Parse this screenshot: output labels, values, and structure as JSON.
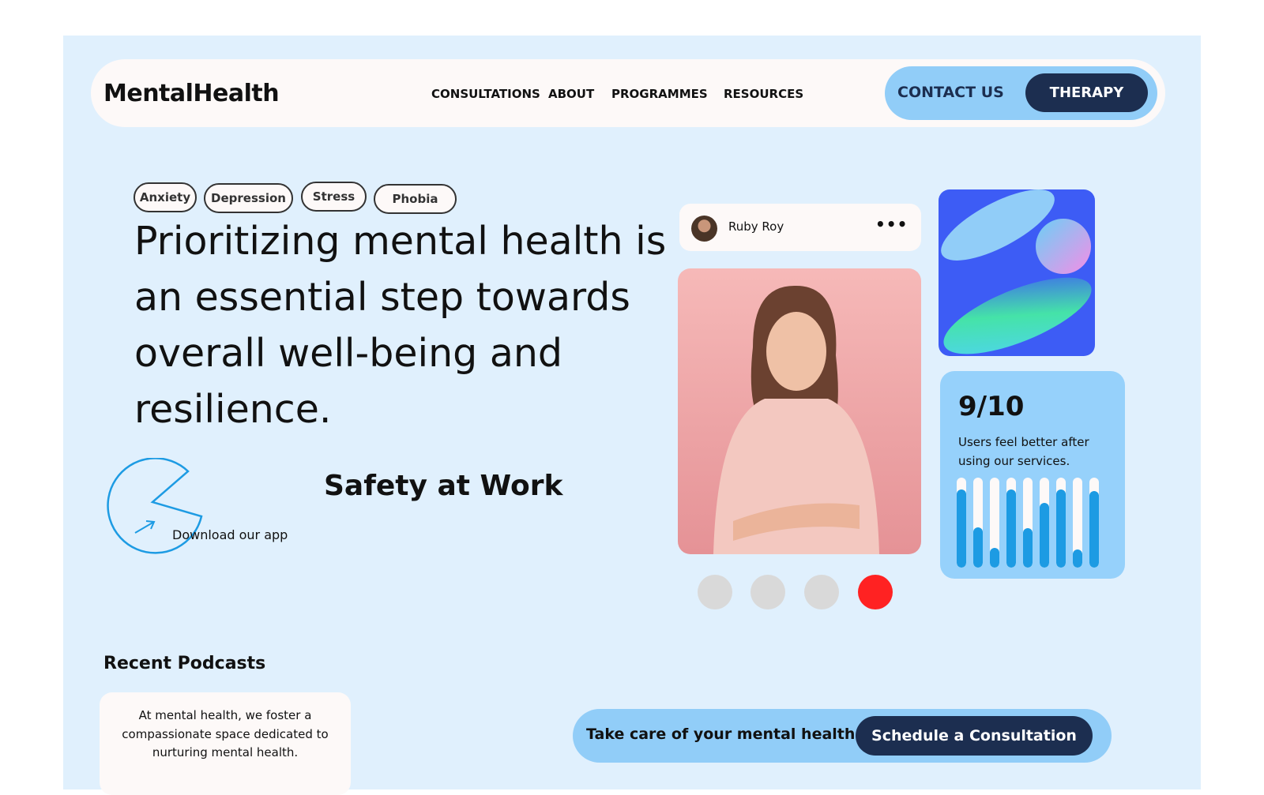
{
  "nav": {
    "logo": "MentalHealth",
    "links": [
      "CONSULTATIONS",
      "ABOUT",
      "PROGRAMMES",
      "RESOURCES"
    ],
    "contact": "CONTACT US",
    "therapy": "THERAPY"
  },
  "hero": {
    "tags": [
      "Anxiety",
      "Depression",
      "Stress",
      "Phobia"
    ],
    "headline": "Prioritizing mental health is an essential step towards overall well-being and resilience.",
    "download": "Download our app",
    "safety": "Safety at Work"
  },
  "profile": {
    "name": "Ruby Roy",
    "menu": "•••"
  },
  "carousel": {
    "count": 4,
    "active": 4,
    "active_color": "#ff2222"
  },
  "stats": {
    "value": "9/10",
    "text": "Users feel better after using our services.",
    "bars": [
      0.87,
      0.45,
      0.22,
      0.87,
      0.44,
      0.72,
      0.87,
      0.2,
      0.85
    ]
  },
  "podcasts": {
    "title": "Recent Podcasts",
    "text": "At mental health, we foster a compassionate space dedicated to nurturing mental health."
  },
  "cta": {
    "text": "Take care of your mental health",
    "button": "Schedule a Consultation"
  },
  "colors": {
    "accent": "#1c2e50",
    "background": "#e0f0fd",
    "bar": "#1d9be3"
  }
}
